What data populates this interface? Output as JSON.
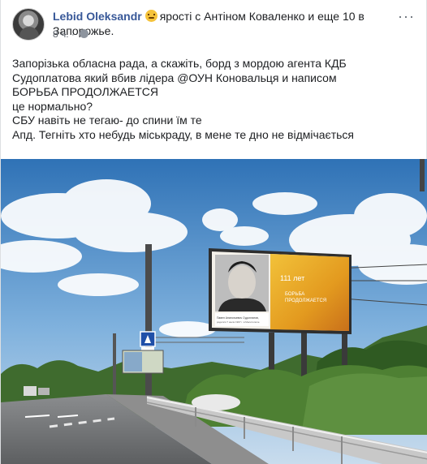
{
  "post": {
    "author": "Lebid Oleksandr",
    "feeling_emoji": "feeling-face-icon",
    "feeling_text": "ярості с Антіном Коваленко и еще 10 в Запорожье.",
    "time": "8 ч.",
    "privacy_icon": "globe-icon",
    "body_lines": [
      "Запорізька обласна рада, а скажіть, борд з мордою агента КДБ",
      "Судоплатова який вбив лідера @ОУН Коновальця и написом",
      "БОРЬБА ПРОДОЛЖАЕТСЯ",
      "це нормально?",
      "СБУ навіть не тегаю- до спини їм те",
      "Апд. Тегніть хто небудь міськраду, в мене те дно не відмічається"
    ]
  },
  "photo": {
    "billboard_headline": "111 лет",
    "billboard_slogan_1": "БОРЬБА",
    "billboard_slogan_2": "ПРОДОЛЖАЕТСЯ",
    "billboard_caption_1": "Павел Анатольевич Судоплатов,",
    "billboard_caption_2": "родился 7 июля 1907 г. в Мелитополе"
  }
}
